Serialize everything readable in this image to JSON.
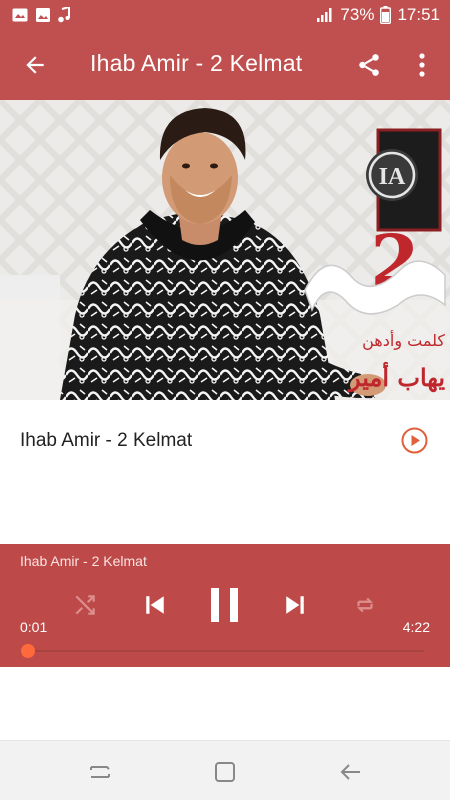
{
  "status_bar": {
    "battery_percent": "73%",
    "time": "17:51",
    "icons": [
      "image-icon",
      "gallery-icon",
      "music-note-icon",
      "signal-icon",
      "battery-icon"
    ]
  },
  "app_bar": {
    "title": "Ihab Amir - 2 Kelmat",
    "icons": [
      "back-arrow-icon",
      "share-icon",
      "more-vert-icon"
    ]
  },
  "cover": {
    "album_art_text_ar_1": "كلمت وأدهن",
    "album_art_text_ar_2": "يهاب أمير",
    "logo_text": "IA",
    "accent": "#c0272d"
  },
  "track_list": [
    {
      "title": "Ihab Amir - 2 Kelmat",
      "icon": "play-circle-icon"
    }
  ],
  "player": {
    "now_playing": "Ihab Amir - 2 Kelmat",
    "current_time": "0:01",
    "total_time": "4:22",
    "progress": 0.004,
    "state": "playing",
    "icons": [
      "shuffle-icon",
      "skip-previous-icon",
      "pause-icon",
      "skip-next-icon",
      "repeat-icon"
    ]
  },
  "nav_bar": {
    "icons": [
      "recent-apps-icon",
      "home-icon",
      "back-icon"
    ]
  },
  "colors": {
    "primary": "#c0504f",
    "player_bg": "#bd4a48",
    "accent_orange": "#ff6a3d",
    "play_icon": "#e0603a"
  }
}
